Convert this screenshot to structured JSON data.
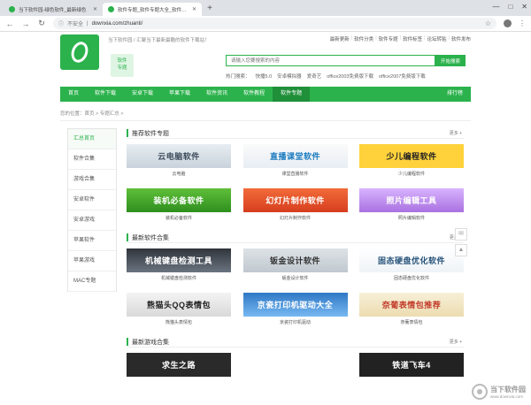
{
  "browser": {
    "tabs": [
      {
        "title": "当下软件园-绿色软件_最新绿色"
      },
      {
        "title": "软件专题_软件专题大全_软件专题"
      }
    ],
    "new_tab": "+",
    "window": {
      "minimize": "—",
      "maximize": "□",
      "close": "✕"
    },
    "address": {
      "security": "不安全",
      "url": "downxia.com/zhuanti/"
    }
  },
  "header": {
    "slogan": "当下软件园 / 汇聚当下最新最酷的软件下载站！",
    "badge_line1": "软件",
    "badge_line2": "专题",
    "top_links": [
      "最新更新",
      "软件分类",
      "软件专题",
      "软件标签",
      "论坛转贴",
      "软件发布"
    ],
    "search": {
      "placeholder": "请输入您要搜索的内容",
      "button": "开始搜索"
    },
    "hot": {
      "label": "热门搜索：",
      "items": [
        "快播5.0",
        "安卓模拟器",
        "爱奇艺",
        "office2003免费版下载",
        "office2007免费版下载"
      ]
    }
  },
  "nav": {
    "items": [
      "首页",
      "软件下载",
      "安卓下载",
      "苹果下载",
      "软件资讯",
      "软件教程",
      "软件专题"
    ],
    "rank": "排行榜"
  },
  "breadcrumb": "您的位置：首页 > 专题汇总 >",
  "sidebar": [
    "汇总首页",
    "软件合集",
    "游戏合集",
    "安卓软件",
    "安卓游戏",
    "苹果软件",
    "苹果游戏",
    "MAC专题"
  ],
  "sections": [
    {
      "title": "推荐软件专题",
      "more": "更多 +",
      "cards": [
        {
          "banner": "云电脑软件",
          "caption": "云电脑"
        },
        {
          "banner": "直播课堂软件",
          "caption": "课堂直播软件"
        },
        {
          "banner": "少儿编程软件",
          "caption": "少儿编程软件"
        }
      ]
    },
    {
      "title": "",
      "more": "",
      "cards": [
        {
          "banner": "装机必备软件",
          "caption": "装机必备软件"
        },
        {
          "banner": "幻灯片制作软件",
          "caption": "幻灯片制作软件"
        },
        {
          "banner": "照片编辑工具",
          "caption": "照片编辑软件"
        }
      ]
    },
    {
      "title": "最新软件合集",
      "more": "更多 +",
      "cards": [
        {
          "banner": "机械键盘检测工具",
          "caption": "机械键盘检测软件"
        },
        {
          "banner": "钣金设计软件",
          "caption": "钣金设计软件"
        },
        {
          "banner": "固态硬盘优化软件",
          "caption": "固态硬盘优化软件"
        }
      ]
    },
    {
      "title": "",
      "more": "",
      "cards": [
        {
          "banner": "熊猫头QQ表情包",
          "caption": "熊猫头表情包"
        },
        {
          "banner": "京瓷打印机驱动大全",
          "caption": "京瓷打印机驱动"
        },
        {
          "banner": "奈葡表情包推荐",
          "caption": "奈葡表情包"
        }
      ]
    },
    {
      "title": "最新游戏合集",
      "more": "更多 +",
      "cards": [
        {
          "banner": "求生之路",
          "caption": ""
        },
        {
          "banner": "",
          "caption": ""
        },
        {
          "banner": "铁道飞车4",
          "caption": ""
        }
      ]
    }
  ],
  "watermark": {
    "name": "当下软件园",
    "domain": "www.downxia.com"
  }
}
